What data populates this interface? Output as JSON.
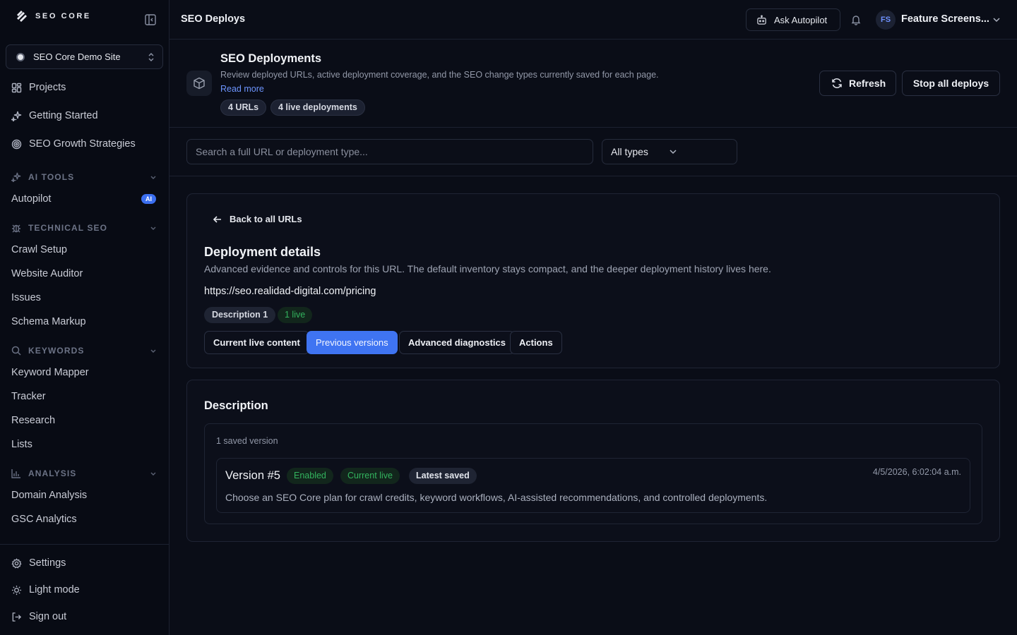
{
  "brand": {
    "name": "SEO CORE"
  },
  "sidebar": {
    "site": "SEO Core Demo Site",
    "main_items": [
      {
        "label": "Projects",
        "icon": "grid-icon"
      },
      {
        "label": "Getting Started",
        "icon": "sparkle-icon"
      },
      {
        "label": "SEO Growth Strategies",
        "icon": "target-icon"
      }
    ],
    "sections": {
      "ai_tools": {
        "label": "AI TOOLS",
        "items": [
          "Autopilot"
        ],
        "badge": "AI"
      },
      "technical_seo": {
        "label": "TECHNICAL SEO",
        "items": [
          "Crawl Setup",
          "Website Auditor",
          "Issues",
          "Schema Markup"
        ]
      },
      "keywords": {
        "label": "KEYWORDS",
        "items": [
          "Keyword Mapper",
          "Tracker",
          "Research",
          "Lists"
        ]
      },
      "analysis": {
        "label": "ANALYSIS",
        "items": [
          "Domain Analysis",
          "GSC Analytics"
        ]
      }
    },
    "footer_items": [
      {
        "label": "Settings",
        "icon": "gear-icon"
      },
      {
        "label": "Light mode",
        "icon": "sun-icon"
      },
      {
        "label": "Sign out",
        "icon": "sign-out-icon"
      }
    ]
  },
  "topbar": {
    "title": "SEO Deploys",
    "ask_autopilot": "Ask Autopilot",
    "avatar_initials": "FS",
    "user_name": "Feature Screens..."
  },
  "page_header": {
    "title": "SEO Deployments",
    "description": "Review deployed URLs, active deployment coverage, and the SEO change types currently saved for each page.",
    "read_more": "Read more",
    "chips": [
      "4 URLs",
      "4 live deployments"
    ],
    "refresh": "Refresh",
    "stop_all": "Stop all deploys"
  },
  "filters": {
    "search_placeholder": "Search a full URL or deployment type...",
    "type_selected": "All types"
  },
  "details": {
    "back": "Back to all URLs",
    "title": "Deployment details",
    "description": "Advanced evidence and controls for this URL. The default inventory stays compact, and the deeper deployment history lives here.",
    "url": "https://seo.realidad-digital.com/pricing",
    "tag_type": "Description 1",
    "tag_live": "1 live",
    "tabs": [
      "Current live content",
      "Previous versions",
      "Advanced diagnostics",
      "Actions"
    ],
    "active_tab": "Previous versions"
  },
  "versions_panel": {
    "title": "Description",
    "saved_count": "1 saved version",
    "versions": [
      {
        "title": "Version #5",
        "tags": [
          "Enabled",
          "Current live",
          "Latest saved"
        ],
        "date": "4/5/2026, 6:02:04 a.m.",
        "text": "Choose an SEO Core plan for crawl credits, keyword workflows, AI-assisted recommendations, and controlled deployments."
      }
    ]
  },
  "colors": {
    "background": "#0a0d17",
    "accent": "#3f74f2",
    "link": "#6d95ff",
    "success": "#33b35e"
  }
}
